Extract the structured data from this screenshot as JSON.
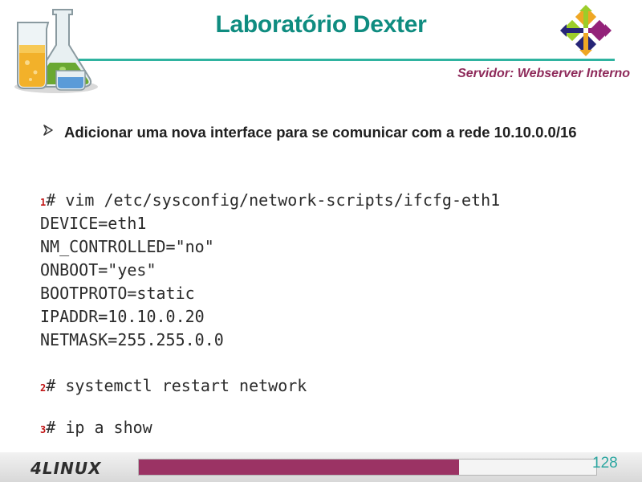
{
  "header": {
    "title": "Laboratório Dexter",
    "subtitle": "Servidor: Webserver Interno"
  },
  "bullet": {
    "text": "Adicionar uma nova interface para se comunicar com a rede 10.10.0.0/16"
  },
  "code": {
    "lines": [
      {
        "step": "1",
        "text": "# vim /etc/sysconfig/network-scripts/ifcfg-eth1"
      },
      {
        "step": "",
        "text": "DEVICE=eth1"
      },
      {
        "step": "",
        "text": "NM_CONTROLLED=\"no\""
      },
      {
        "step": "",
        "text": "ONBOOT=\"yes\""
      },
      {
        "step": "",
        "text": "BOOTPROTO=static"
      },
      {
        "step": "",
        "text": "IPADDR=10.10.0.20"
      },
      {
        "step": "",
        "text": "NETMASK=255.255.0.0"
      },
      {
        "step": "2",
        "text": "# systemctl restart network"
      },
      {
        "step": "3",
        "text": "# ip a show"
      }
    ]
  },
  "footer": {
    "brand": "4LINUX",
    "page_number": "128",
    "progress_fraction": 0.7
  },
  "colors": {
    "title": "#0f8c80",
    "subtitle": "#8e2a5a",
    "step_number": "#c21414",
    "progress": "#9b3364",
    "page_number": "#2aa6a0"
  },
  "icons": {
    "lab_logo": "laboratory-beakers-icon",
    "os_logo": "centos-logo-icon",
    "bullet": "arrow-bullet-icon"
  }
}
